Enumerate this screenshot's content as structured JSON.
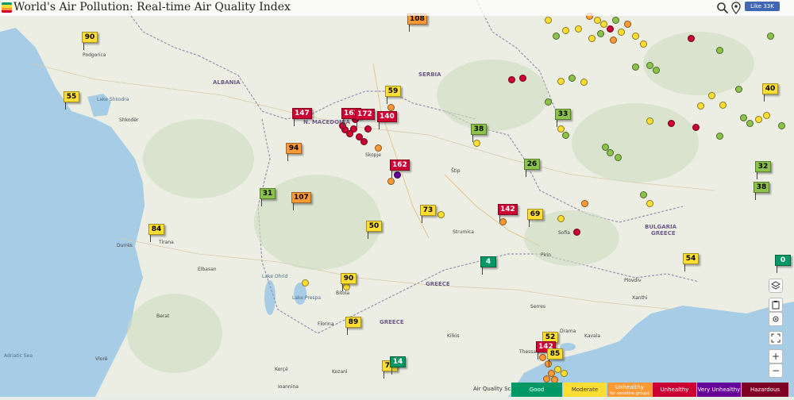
{
  "title": "World's Air Pollution: Real-time Air Quality Index",
  "facebook": {
    "label": "Like 33K"
  },
  "colors": {
    "good": "#009966",
    "moderate": "#ffde33",
    "usg": "#ff9933",
    "unhealthy": "#cc0033",
    "very_unhealthy": "#660099",
    "hazardous": "#7e0023"
  },
  "markers": [
    {
      "value": "90",
      "level": "moderate"
    },
    {
      "value": "108",
      "level": "usg"
    },
    {
      "value": "55",
      "level": "moderate"
    },
    {
      "value": "147",
      "level": "unhealthy"
    },
    {
      "value": "163",
      "level": "unhealthy"
    },
    {
      "value": "172",
      "level": "unhealthy"
    },
    {
      "value": "140",
      "level": "unhealthy"
    },
    {
      "value": "59",
      "level": "moderate"
    },
    {
      "value": "94",
      "level": "usg"
    },
    {
      "value": "162",
      "level": "unhealthy"
    },
    {
      "value": "38",
      "level": "good2"
    },
    {
      "value": "33",
      "level": "good2"
    },
    {
      "value": "40",
      "level": "moderate"
    },
    {
      "value": "26",
      "level": "good2"
    },
    {
      "value": "32",
      "level": "good2"
    },
    {
      "value": "38",
      "level": "good2"
    },
    {
      "value": "31",
      "level": "good2"
    },
    {
      "value": "107",
      "level": "usg"
    },
    {
      "value": "73",
      "level": "moderate"
    },
    {
      "value": "142",
      "level": "unhealthy"
    },
    {
      "value": "69",
      "level": "moderate"
    },
    {
      "value": "84",
      "level": "moderate"
    },
    {
      "value": "50",
      "level": "moderate"
    },
    {
      "value": "4",
      "level": "good"
    },
    {
      "value": "54",
      "level": "moderate"
    },
    {
      "value": "0",
      "level": "good"
    },
    {
      "value": "90",
      "level": "moderate"
    },
    {
      "value": "89",
      "level": "moderate"
    },
    {
      "value": "52",
      "level": "moderate"
    },
    {
      "value": "142",
      "level": "unhealthy"
    },
    {
      "value": "85",
      "level": "moderate"
    },
    {
      "value": "71",
      "level": "moderate"
    },
    {
      "value": "14",
      "level": "good"
    }
  ],
  "map_labels": {
    "podgorica": "Podgorica",
    "shkoder": "Shkodër",
    "albania": "ALBANIA",
    "n_macedonia": "N. MACEDONIA",
    "serbia": "SERBIA",
    "bulgaria": "BULGARIA",
    "greece_1": "GREECE",
    "greece_2": "GREECE",
    "greece_3": "GREECE",
    "tirana": "Tirana",
    "durres": "Durrës",
    "elbasan": "Elbasan",
    "berat": "Berat",
    "vlore": "Vlorë",
    "korce": "Korçë",
    "bitola": "Bitola",
    "ohrid_lake": "Lake Ohrid",
    "prespa_lake": "Lake Prespa",
    "skopje": "Skopje",
    "stip": "Štip",
    "strumica": "Strumica",
    "sofia": "Sofia",
    "pirin": "Pirin",
    "kozani": "Kozani",
    "thessaloniki": "Thessaloniki",
    "kavala": "Kavala",
    "drama": "Drama",
    "xanthi": "Xanthi",
    "adriatic": "Adriatic Sea",
    "shkodra_lake": "Lake Shkodra",
    "ioannina": "Ioannina",
    "florina": "Florina",
    "kilkis": "Kilkis",
    "serres": "Serres",
    "plovdiv": "Plovdiv"
  },
  "controls": {
    "zoom_in": "+",
    "zoom_out": "−"
  },
  "scale": {
    "label": "Air Quality Scale",
    "levels": [
      {
        "name": "Good",
        "color": "#009966"
      },
      {
        "name": "Moderate",
        "color": "#ffde33"
      },
      {
        "name": "Unhealthy",
        "sub": "for sensitive groups",
        "color": "#ff9933"
      },
      {
        "name": "Unhealthy",
        "color": "#cc0033"
      },
      {
        "name": "Very Unhealthy",
        "color": "#660099"
      },
      {
        "name": "Hazardous",
        "color": "#7e0023"
      }
    ]
  }
}
